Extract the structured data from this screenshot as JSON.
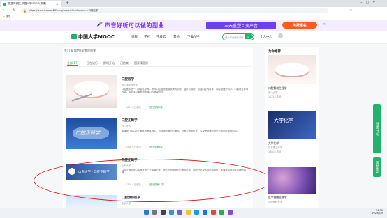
{
  "browser": {
    "tab_title": "数据库课程_中国大学MOOC(慕课)",
    "url": "https://www.icourse163.org/search.htm?search=口腔医学",
    "bookmark": "选项"
  },
  "banner": {
    "text": "声音好听可以做的副业",
    "offer": "三天重塑百变声音",
    "button": "免费报名"
  },
  "site": {
    "logo": "中国大学MOOC",
    "nav": [
      "课程",
      "学校",
      "学校云",
      "其他",
      "下载APP"
    ],
    "search_placeholder": "搜索感兴趣的课程",
    "user": "个人中心"
  },
  "results": {
    "summary": "共17条'口腔医学'相关结果",
    "filters": [
      "全部(17)",
      "正在进行",
      "即将开始",
      "已结束",
      "国家精品课"
    ],
    "cards": [
      {
        "title": "口腔医学",
        "school": "哈尔滨医科大学",
        "desc": "口腔医学是一门综合性学科，研究口腔及颌面部疾病的诊断、治疗与预防，包括口腔内科学、口腔颌面外科学、口腔修复学等内容，帮助学习者系统掌握口腔健康知识。",
        "meta": "2079人已参加",
        "status": "进行至第5周"
      },
      {
        "title": "口腔正畸学",
        "school": "四川大学",
        "desc": "本课程介绍口腔正畸学的基本理论，包括错颌畸形的病因、诊断与矫治方法，以及矫治器的设计与临床应用等内容。",
        "meta": "1506人已参加",
        "status": "进行至第9周"
      },
      {
        "title": "口腔正畸学",
        "school": "山东大学",
        "desc": "口腔正畸学是口腔医学的一个重要分支，研究牙颌面畸形的病因机制、诊断分析及其预防和治疗，本课程将结合临床病例讲解。",
        "meta": "1179人已参加",
        "status": "进行至第11周"
      },
      {
        "title": "口腔预防医学",
        "school": "北京大学",
        "desc": "",
        "meta": "",
        "status": ""
      }
    ]
  },
  "sidebar": {
    "title": "为你推荐",
    "items": [
      {
        "title": "口腔解剖生理学",
        "school": "四川大学",
        "meta": "1525人参加"
      },
      {
        "title": "大学化学",
        "school": "华东理工大学",
        "meta": "3680人参加"
      },
      {
        "title": "医学细胞生物学",
        "school": "中国医科大学",
        "meta": "2011人参加"
      }
    ],
    "float_labels": [
      "数据分析",
      "课程推荐"
    ]
  },
  "taskbar": {
    "time": "14:30",
    "date": "2023/5/9"
  },
  "colors": {
    "brand_green": "#20b26b",
    "banner_purple": "#6b3ff2",
    "annotation_red": "#d11111"
  }
}
